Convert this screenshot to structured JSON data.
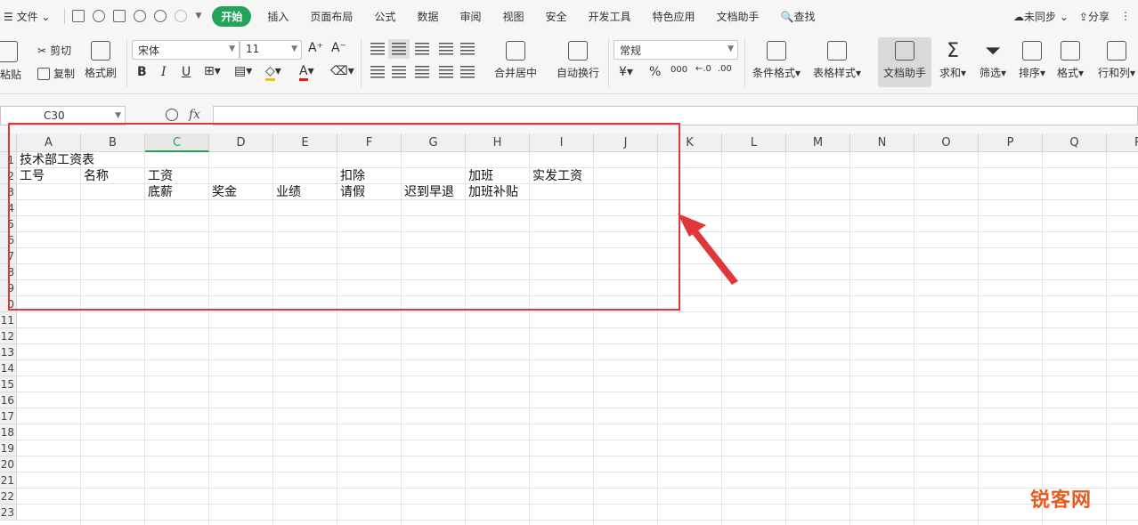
{
  "menubar": {
    "file": "文件",
    "tabs": [
      "开始",
      "插入",
      "页面布局",
      "公式",
      "数据",
      "审阅",
      "视图",
      "安全",
      "开发工具",
      "特色应用",
      "文档助手"
    ],
    "search": "查找",
    "sync": "未同步",
    "share": "分享"
  },
  "ribbon": {
    "paste": "粘贴",
    "cut": "剪切",
    "copy": "复制",
    "format_painter": "格式刷",
    "font_name": "宋体",
    "font_size": "11",
    "bold": "B",
    "italic": "I",
    "underline": "U",
    "merge_center": "合并居中",
    "wrap_text": "自动换行",
    "number_format": "常规",
    "percent": "%",
    "thousands": "000",
    "cond_format": "条件格式",
    "table_style": "表格样式",
    "doc_assistant": "文档助手",
    "sum": "求和",
    "filter": "筛选",
    "sort": "排序",
    "format": "格式",
    "row_col": "行和列"
  },
  "formula_bar": {
    "name_box": "C30",
    "fx": "fx",
    "value": ""
  },
  "grid": {
    "columns": [
      "A",
      "B",
      "C",
      "D",
      "E",
      "F",
      "G",
      "H",
      "I",
      "J",
      "K",
      "L",
      "M",
      "N",
      "O",
      "P",
      "Q",
      "R"
    ],
    "selected_column": "C",
    "row_labels": [
      "1",
      "2",
      "3",
      "4",
      "5",
      "6",
      "7",
      "8",
      "9",
      "0",
      "11",
      "12",
      "13",
      "14",
      "15",
      "16",
      "17",
      "18",
      "19",
      "20",
      "21",
      "22",
      "23"
    ],
    "cells": {
      "A1": "技术部工资表",
      "A2": "工号",
      "B2": "名称",
      "C2": "工资",
      "F2": "扣除",
      "H2": "加班",
      "I2": "实发工资",
      "C3": "底薪",
      "D3": "奖金",
      "E3": "业绩",
      "F3": "请假",
      "G3": "迟到早退",
      "H3": "加班补贴"
    }
  },
  "annotation_color": "#e0373b",
  "accent_color": "#23a45a",
  "watermark": "锐客网"
}
